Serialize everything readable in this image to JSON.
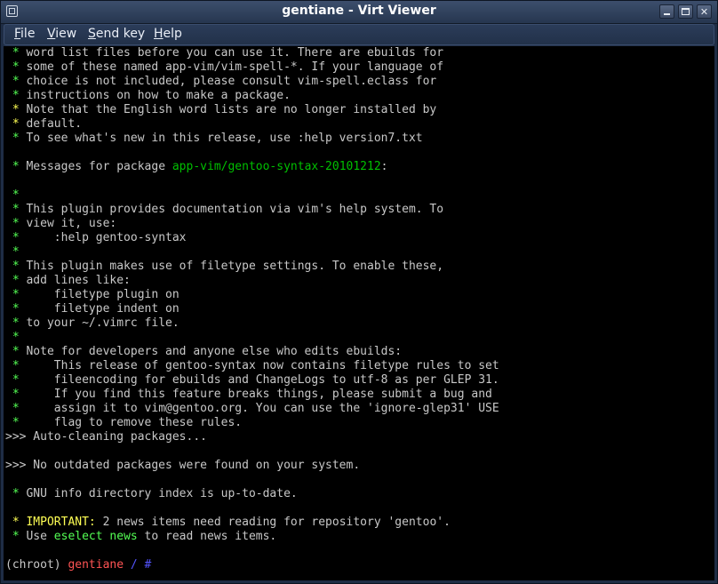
{
  "window": {
    "title": "gentiane - Virt Viewer"
  },
  "menubar": {
    "items": [
      {
        "accel": "F",
        "rest": "ile"
      },
      {
        "accel": "V",
        "rest": "iew"
      },
      {
        "accel": "S",
        "rest": "end key"
      },
      {
        "accel": "H",
        "rest": "elp"
      }
    ]
  },
  "terminal": {
    "lines": [
      [
        {
          "t": " * ",
          "c": "g"
        },
        {
          "t": "word list files before you can use it. There are ebuilds for"
        }
      ],
      [
        {
          "t": " * ",
          "c": "g"
        },
        {
          "t": "some of these named app-vim/vim-spell-*. If your language of"
        }
      ],
      [
        {
          "t": " * ",
          "c": "g"
        },
        {
          "t": "choice is not included, please consult vim-spell.eclass for"
        }
      ],
      [
        {
          "t": " * ",
          "c": "g"
        },
        {
          "t": "instructions on how to make a package."
        }
      ],
      [
        {
          "t": " * ",
          "c": "y"
        },
        {
          "t": "Note that the English word lists are no longer installed by"
        }
      ],
      [
        {
          "t": " * ",
          "c": "y"
        },
        {
          "t": "default."
        }
      ],
      [
        {
          "t": " * ",
          "c": "g"
        },
        {
          "t": "To see what's new in this release, use :help version7.txt"
        }
      ],
      [],
      [
        {
          "t": " * ",
          "c": "g"
        },
        {
          "t": "Messages for package "
        },
        {
          "t": "app-vim/gentoo-syntax-20101212",
          "c": "gt"
        },
        {
          "t": ":"
        }
      ],
      [],
      [
        {
          "t": " * ",
          "c": "g"
        }
      ],
      [
        {
          "t": " * ",
          "c": "g"
        },
        {
          "t": "This plugin provides documentation via vim's help system. To"
        }
      ],
      [
        {
          "t": " * ",
          "c": "g"
        },
        {
          "t": "view it, use:"
        }
      ],
      [
        {
          "t": " * ",
          "c": "g"
        },
        {
          "t": "    :help gentoo-syntax"
        }
      ],
      [
        {
          "t": " * ",
          "c": "g"
        }
      ],
      [
        {
          "t": " * ",
          "c": "g"
        },
        {
          "t": "This plugin makes use of filetype settings. To enable these,"
        }
      ],
      [
        {
          "t": " * ",
          "c": "g"
        },
        {
          "t": "add lines like:"
        }
      ],
      [
        {
          "t": " * ",
          "c": "g"
        },
        {
          "t": "    filetype plugin on"
        }
      ],
      [
        {
          "t": " * ",
          "c": "g"
        },
        {
          "t": "    filetype indent on"
        }
      ],
      [
        {
          "t": " * ",
          "c": "g"
        },
        {
          "t": "to your ~/.vimrc file."
        }
      ],
      [
        {
          "t": " * ",
          "c": "g"
        }
      ],
      [
        {
          "t": " * ",
          "c": "g"
        },
        {
          "t": "Note for developers and anyone else who edits ebuilds:"
        }
      ],
      [
        {
          "t": " * ",
          "c": "g"
        },
        {
          "t": "    This release of gentoo-syntax now contains filetype rules to set"
        }
      ],
      [
        {
          "t": " * ",
          "c": "g"
        },
        {
          "t": "    fileencoding for ebuilds and ChangeLogs to utf-8 as per GLEP 31."
        }
      ],
      [
        {
          "t": " * ",
          "c": "g"
        },
        {
          "t": "    If you find this feature breaks things, please submit a bug and"
        }
      ],
      [
        {
          "t": " * ",
          "c": "g"
        },
        {
          "t": "    assign it to vim@gentoo.org. You can use the 'ignore-glep31' USE"
        }
      ],
      [
        {
          "t": " * ",
          "c": "g"
        },
        {
          "t": "    flag to remove these rules."
        }
      ],
      [
        {
          "t": ">>> Auto-cleaning packages..."
        }
      ],
      [],
      [
        {
          "t": ">>> No outdated packages were found on your system."
        }
      ],
      [],
      [
        {
          "t": " * ",
          "c": "g"
        },
        {
          "t": "GNU info directory index is up-to-date."
        }
      ],
      [],
      [
        {
          "t": " * ",
          "c": "y"
        },
        {
          "t": "IMPORTANT:",
          "c": "y"
        },
        {
          "t": " 2 news items need reading for repository 'gentoo'."
        }
      ],
      [
        {
          "t": " * ",
          "c": "g"
        },
        {
          "t": "Use "
        },
        {
          "t": "eselect news",
          "c": "g"
        },
        {
          "t": " to read news items."
        }
      ],
      [],
      [
        {
          "t": "(chroot) "
        },
        {
          "t": "gentiane",
          "c": "r"
        },
        {
          "t": " / #",
          "c": "b"
        },
        {
          "t": " "
        }
      ]
    ]
  }
}
